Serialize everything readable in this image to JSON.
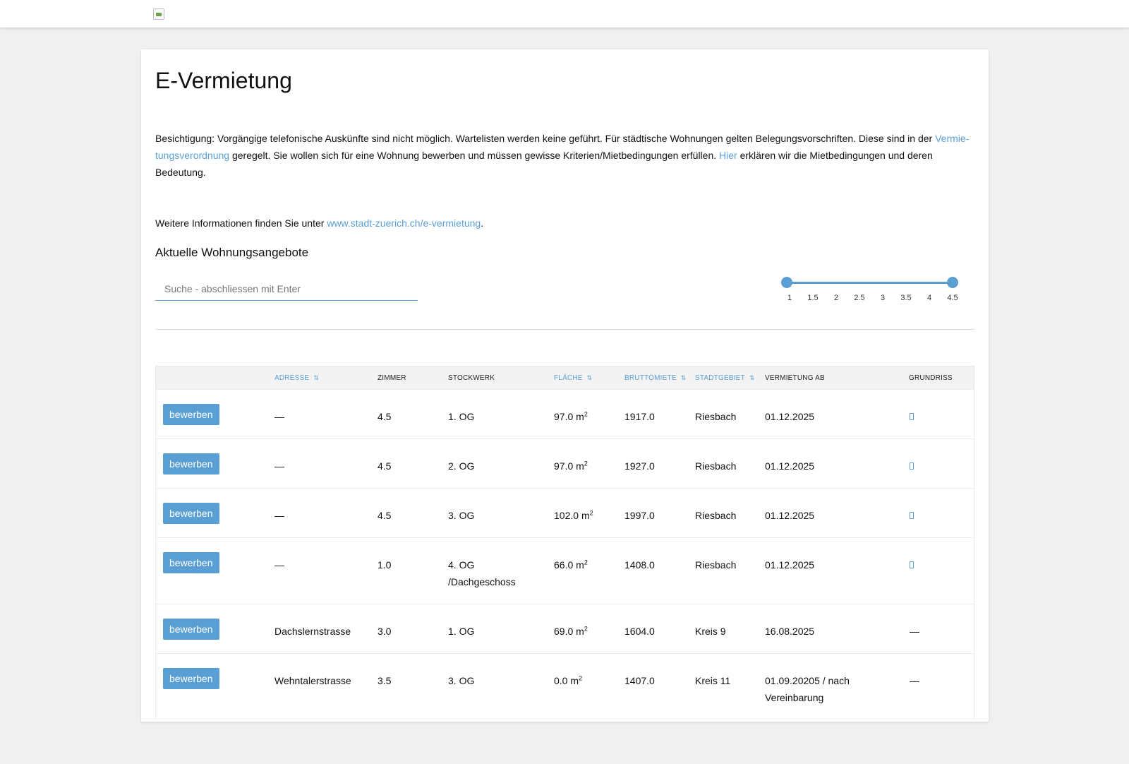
{
  "header": {
    "logo_icon": "broken-image-icon"
  },
  "page": {
    "title": "E-Vermietung",
    "intro": {
      "text_1": "Besichtigung: Vorgängige telefonische Auskünfte sind nicht möglich. Wartelisten werden keine geführt. Für städtische Wohnungen gelten Belegungsvorschriften. Diese sind in der ",
      "link_1": "Vermie-tungsverordnung",
      "text_2": " geregelt. Sie wollen sich für eine Wohnung bewerben und müssen gewisse Kriterien/Mietbedingungen erfüllen. ",
      "link_2": "Hier",
      "text_3": " erklären wir die Mietbedingungen und deren Bedeutung."
    },
    "info": {
      "text_1": "Weitere Informationen finden Sie unter ",
      "link": "www.stadt-zuerich.ch/e-vermietung",
      "text_2": "."
    },
    "section_title": "Aktuelle Wohnungsangebote"
  },
  "search": {
    "placeholder": "Suche - abschliessen mit Enter",
    "value": ""
  },
  "rooms_filter": {
    "ticks": [
      "1",
      "1.5",
      "2",
      "2.5",
      "3",
      "3.5",
      "4",
      "4.5"
    ],
    "min": 1,
    "max": 4.5,
    "selected_min": 1,
    "selected_max": 4.5
  },
  "table": {
    "headers": {
      "address": "Adresse",
      "rooms": "Zimmer",
      "floor": "Stockwerk",
      "area": "Fläche",
      "rent": "Bruttomiete",
      "district": "Stadtgebiet",
      "available": "Vermietung ab",
      "floorplan": "Grundriss"
    },
    "sort_icon": "sort-icon",
    "apply_label": "bewerben",
    "area_unit": "m",
    "area_exp": "2",
    "rows": [
      {
        "address": "—",
        "rooms": "4.5",
        "floor": "1. OG",
        "area": "97.0",
        "rent": "1917.0",
        "district": "Riesbach",
        "available": "01.12.2025",
        "floorplan": "icon"
      },
      {
        "address": "—",
        "rooms": "4.5",
        "floor": "2. OG",
        "area": "97.0",
        "rent": "1927.0",
        "district": "Riesbach",
        "available": "01.12.2025",
        "floorplan": "icon"
      },
      {
        "address": "—",
        "rooms": "4.5",
        "floor": "3. OG",
        "area": "102.0",
        "rent": "1997.0",
        "district": "Riesbach",
        "available": "01.12.2025",
        "floorplan": "icon"
      },
      {
        "address": "—",
        "rooms": "1.0",
        "floor": "4. OG /Dachgeschoss",
        "area": "66.0",
        "rent": "1408.0",
        "district": "Riesbach",
        "available": "01.12.2025",
        "floorplan": "icon"
      },
      {
        "address": "Dachslernstrasse",
        "rooms": "3.0",
        "floor": "1. OG",
        "area": "69.0",
        "rent": "1604.0",
        "district": "Kreis 9",
        "available": "16.08.2025",
        "floorplan": "—"
      },
      {
        "address": "Wehntalerstrasse",
        "rooms": "3.5",
        "floor": "3. OG",
        "area": "0.0",
        "rent": "1407.0",
        "district": "Kreis 11",
        "available": "01.09.20205 / nach Vereinbarung",
        "floorplan": "—"
      }
    ]
  }
}
